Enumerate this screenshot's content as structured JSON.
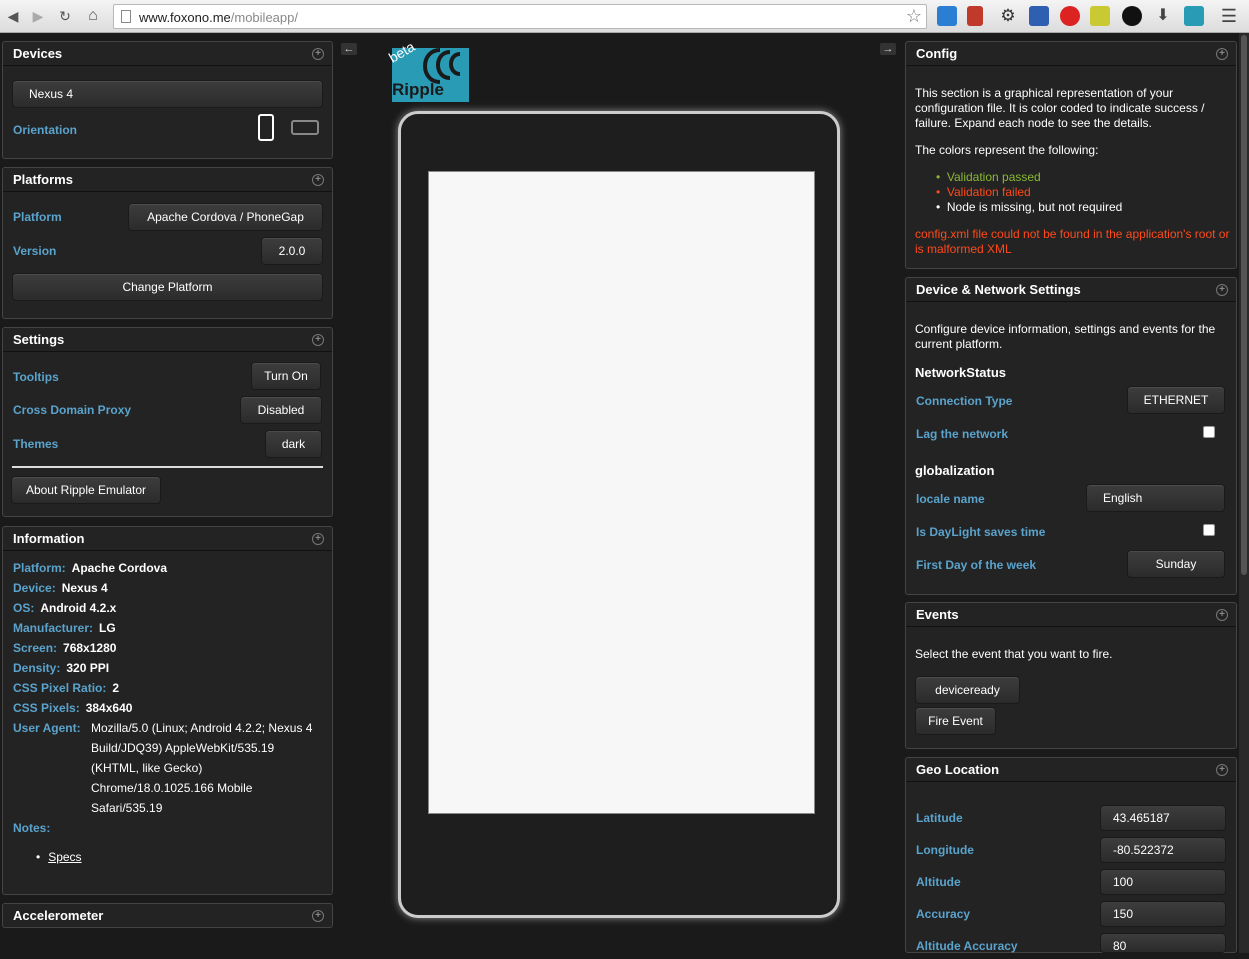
{
  "browser": {
    "url_host": "www.foxono.me",
    "url_path": "/mobileapp/"
  },
  "logo": {
    "beta": "beta",
    "name": "Ripple"
  },
  "devices": {
    "title": "Devices",
    "device": "Nexus 4",
    "orientation_label": "Orientation"
  },
  "platforms": {
    "title": "Platforms",
    "platform_label": "Platform",
    "platform_value": "Apache Cordova / PhoneGap",
    "version_label": "Version",
    "version_value": "2.0.0",
    "change_button": "Change Platform"
  },
  "settings": {
    "title": "Settings",
    "tooltips_label": "Tooltips",
    "tooltips_value": "Turn On",
    "proxy_label": "Cross Domain Proxy",
    "proxy_value": "Disabled",
    "themes_label": "Themes",
    "themes_value": "dark",
    "about_button": "About Ripple Emulator"
  },
  "information": {
    "title": "Information",
    "rows": [
      {
        "k": "Platform:",
        "v": "Apache Cordova"
      },
      {
        "k": "Device:",
        "v": "Nexus 4"
      },
      {
        "k": "OS:",
        "v": "Android 4.2.x"
      },
      {
        "k": "Manufacturer:",
        "v": "LG"
      },
      {
        "k": "Screen:",
        "v": "768x1280"
      },
      {
        "k": "Density:",
        "v": "320 PPI"
      },
      {
        "k": "CSS Pixel Ratio:",
        "v": "2"
      },
      {
        "k": "CSS Pixels:",
        "v": "384x640"
      }
    ],
    "ua_label": "User Agent:",
    "ua_lines": [
      "Mozilla/5.0 (Linux; Android 4.2.2; Nexus 4",
      "Build/JDQ39) AppleWebKit/535.19",
      "(KHTML, like Gecko)",
      "Chrome/18.0.1025.166 Mobile",
      "Safari/535.19"
    ],
    "notes_label": "Notes:",
    "specs_link": "Specs"
  },
  "accelerometer": {
    "title": "Accelerometer"
  },
  "config": {
    "title": "Config",
    "intro": "This section is a graphical representation of your configuration file. It is color coded to indicate success / failure. Expand each node to see the details.",
    "colors_intro": "The colors represent the following:",
    "legend": [
      {
        "text": "Validation passed",
        "color": "#8ab833"
      },
      {
        "text": "Validation failed",
        "color": "#ff4a1a"
      },
      {
        "text": "Node is missing, but not required",
        "color": "#ffffff"
      }
    ],
    "error": "config.xml file could not be found in the application's root or is malformed XML",
    "error_color": "#ff4a1a"
  },
  "device_network": {
    "title": "Device & Network Settings",
    "intro": "Configure device information, settings and events for the current platform.",
    "network_heading": "NetworkStatus",
    "connection_label": "Connection Type",
    "connection_value": "ETHERNET",
    "lag_label": "Lag the network",
    "glob_heading": "globalization",
    "locale_label": "locale name",
    "locale_value": "English",
    "daylight_label": "Is DayLight saves time",
    "firstday_label": "First Day of the week",
    "firstday_value": "Sunday"
  },
  "events": {
    "title": "Events",
    "intro": "Select the event that you want to fire.",
    "event_value": "deviceready",
    "fire_button": "Fire Event"
  },
  "geo": {
    "title": "Geo Location",
    "rows": [
      {
        "label": "Latitude",
        "value": "43.465187"
      },
      {
        "label": "Longitude",
        "value": "-80.522372"
      },
      {
        "label": "Altitude",
        "value": "100"
      },
      {
        "label": "Accuracy",
        "value": "150"
      },
      {
        "label": "Altitude Accuracy",
        "value": "80"
      }
    ]
  },
  "colors": {
    "label_blue": "#5aa3cc",
    "panel_bg": "#232323",
    "page_bg": "#1a1a1a"
  }
}
